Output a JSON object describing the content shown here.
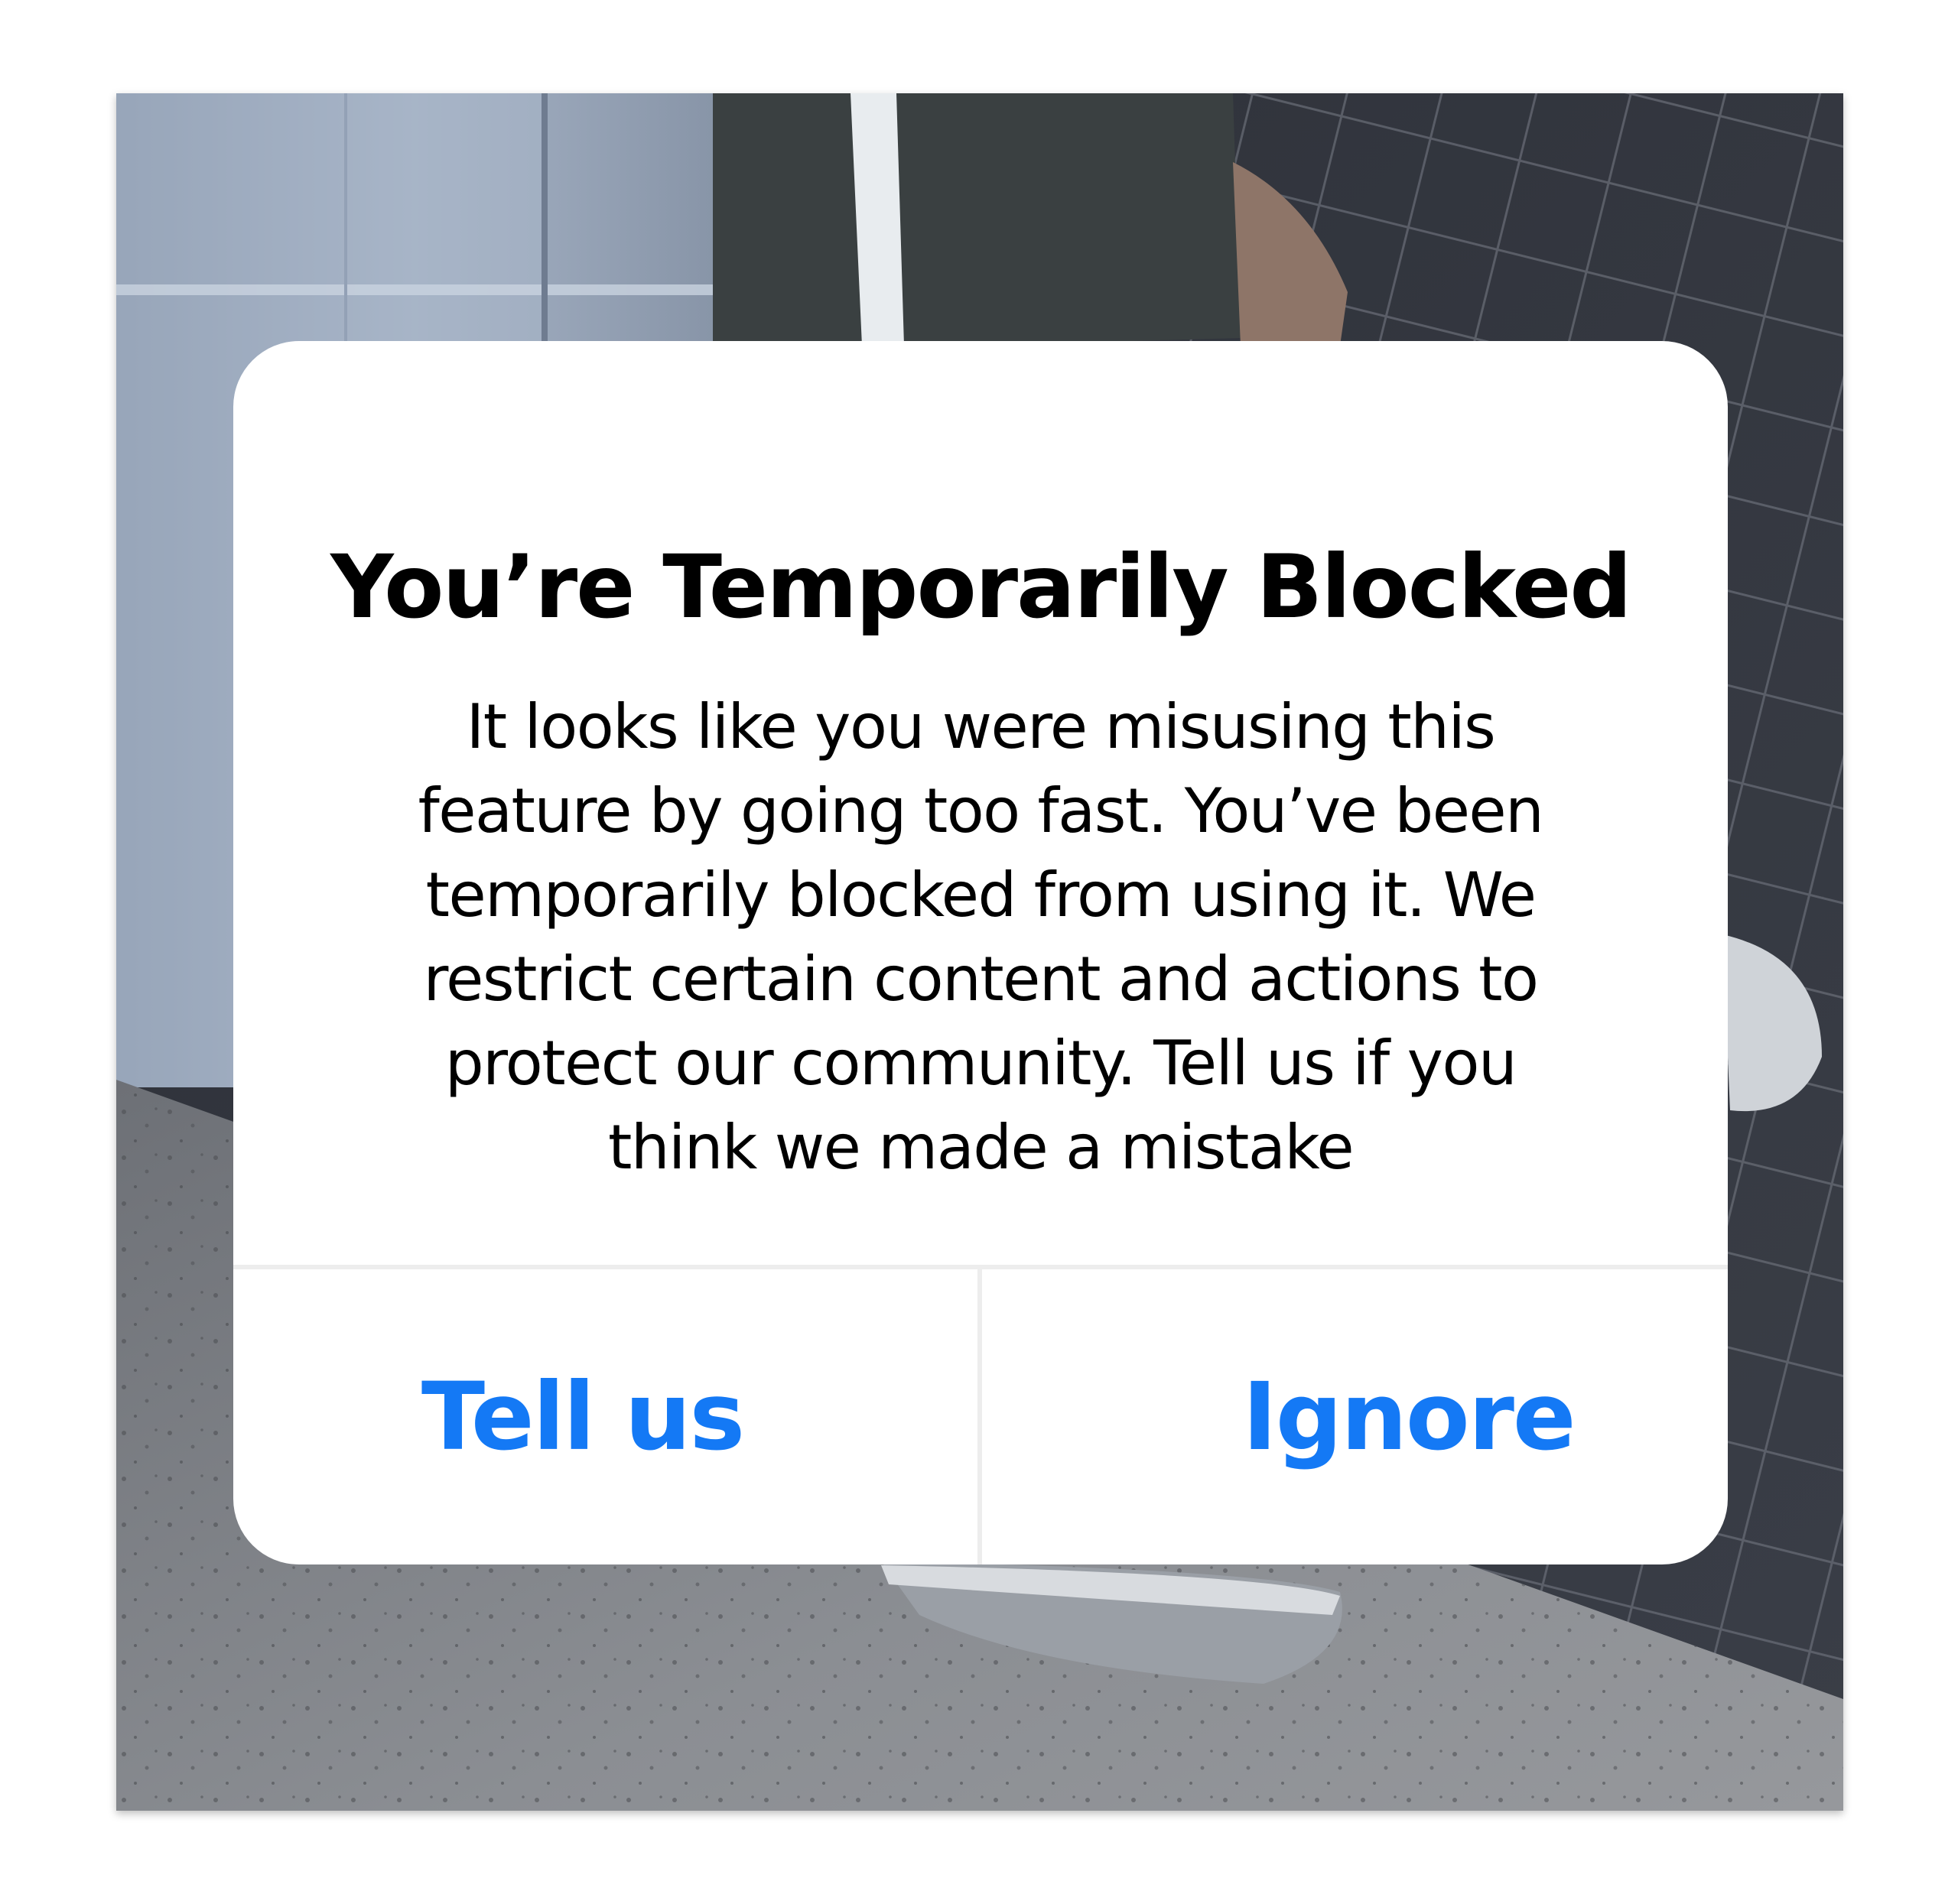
{
  "dialog": {
    "title": "You’re Temporarily Blocked",
    "body_lines": [
      "It looks like you were misusing this",
      "feature by going too fast. You’ve been",
      "temporarily blocked from using it. We",
      "restrict certain content and actions to",
      "protect our community. Tell us if you",
      "think we made a mistake"
    ],
    "buttons": {
      "tell_us": "Tell us",
      "ignore": "Ignore"
    }
  },
  "colors": {
    "button_text": "#1479f5",
    "dialog_bg": "#ffffff",
    "divider": "#ededed"
  }
}
